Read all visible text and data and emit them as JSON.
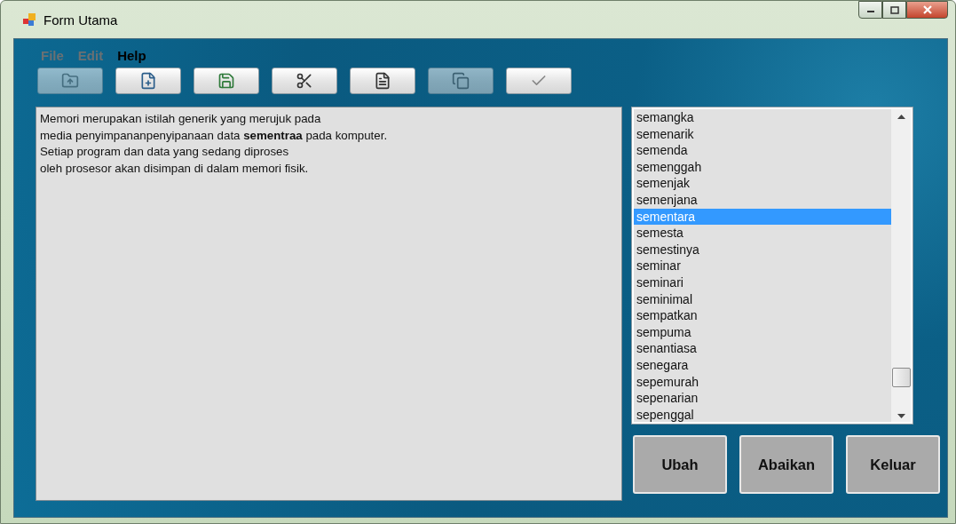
{
  "window": {
    "title": "Form Utama"
  },
  "menu": [
    {
      "label": "File",
      "disabled": true
    },
    {
      "label": "Edit",
      "disabled": true
    },
    {
      "label": "Help",
      "disabled": false
    }
  ],
  "toolbar": [
    {
      "kind": "open",
      "disabled": true
    },
    {
      "kind": "new",
      "disabled": false
    },
    {
      "kind": "save",
      "disabled": false
    },
    {
      "kind": "cut",
      "disabled": false
    },
    {
      "kind": "copy",
      "disabled": false
    },
    {
      "kind": "paste",
      "disabled": true
    },
    {
      "kind": "check",
      "disabled": false
    }
  ],
  "editor": {
    "lines": [
      "Memori merupakan istilah generik yang merujuk pada",
      "media penyimpananpenyipanaan data **sementraa** pada komputer.",
      "Setiap program dan data yang sedang diproses",
      "oleh prosesor akan disimpan di dalam memori fisik."
    ]
  },
  "suggestions": [
    {
      "label": "semangka",
      "selected": false
    },
    {
      "label": "semenarik",
      "selected": false
    },
    {
      "label": "semenda",
      "selected": false
    },
    {
      "label": "semenggah",
      "selected": false
    },
    {
      "label": "semenjak",
      "selected": false
    },
    {
      "label": "semenjana",
      "selected": false
    },
    {
      "label": "sementara",
      "selected": true
    },
    {
      "label": "semesta",
      "selected": false
    },
    {
      "label": "semestinya",
      "selected": false
    },
    {
      "label": "seminar",
      "selected": false
    },
    {
      "label": "seminari",
      "selected": false
    },
    {
      "label": "seminimal",
      "selected": false
    },
    {
      "label": "sempatkan",
      "selected": false
    },
    {
      "label": "sempuma",
      "selected": false
    },
    {
      "label": "senantiasa",
      "selected": false
    },
    {
      "label": "senegara",
      "selected": false
    },
    {
      "label": "sepemurah",
      "selected": false
    },
    {
      "label": "sepenarian",
      "selected": false
    },
    {
      "label": "sepenggal",
      "selected": false
    }
  ],
  "buttons": [
    {
      "label": "Ubah"
    },
    {
      "label": "Abaikan"
    },
    {
      "label": "Keluar"
    }
  ]
}
